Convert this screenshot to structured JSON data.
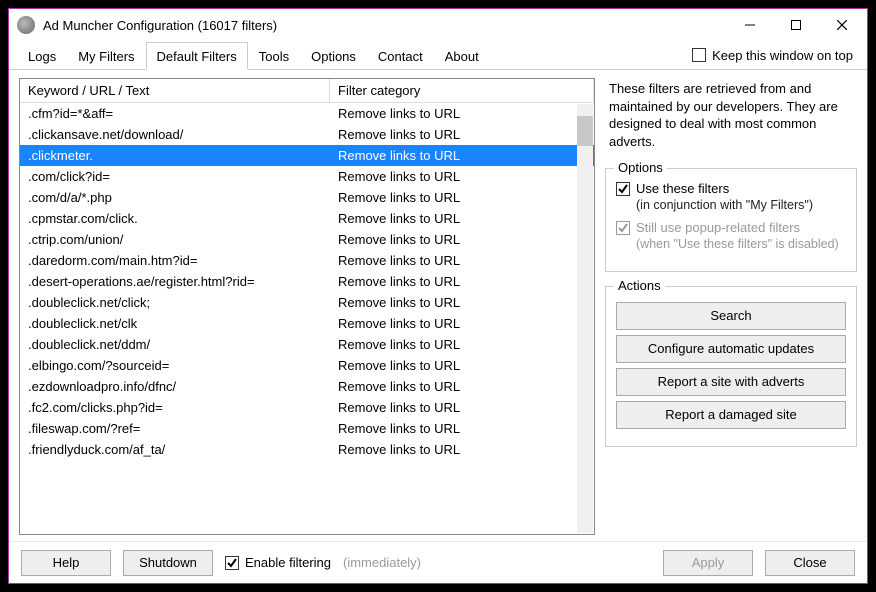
{
  "window": {
    "title": "Ad Muncher Configuration (16017 filters)"
  },
  "tabs": [
    "Logs",
    "My Filters",
    "Default Filters",
    "Tools",
    "Options",
    "Contact",
    "About"
  ],
  "active_tab": "Default Filters",
  "keep_on_top": {
    "label": "Keep this window on top",
    "checked": false
  },
  "table": {
    "headers": {
      "col1": "Keyword / URL / Text",
      "col2": "Filter category"
    },
    "rows": [
      {
        "k": ".cfm?id=*&aff=",
        "c": "Remove links to URL",
        "sel": false
      },
      {
        "k": ".clickansave.net/download/",
        "c": "Remove links to URL",
        "sel": false
      },
      {
        "k": ".clickmeter.",
        "c": "Remove links to URL",
        "sel": true
      },
      {
        "k": ".com/click?id=",
        "c": "Remove links to URL",
        "sel": false
      },
      {
        "k": ".com/d/a/*.php",
        "c": "Remove links to URL",
        "sel": false
      },
      {
        "k": ".cpmstar.com/click.",
        "c": "Remove links to URL",
        "sel": false
      },
      {
        "k": ".ctrip.com/union/",
        "c": "Remove links to URL",
        "sel": false
      },
      {
        "k": ".daredorm.com/main.htm?id=",
        "c": "Remove links to URL",
        "sel": false
      },
      {
        "k": ".desert-operations.ae/register.html?rid=",
        "c": "Remove links to URL",
        "sel": false
      },
      {
        "k": ".doubleclick.net/click;",
        "c": "Remove links to URL",
        "sel": false
      },
      {
        "k": ".doubleclick.net/clk",
        "c": "Remove links to URL",
        "sel": false
      },
      {
        "k": ".doubleclick.net/ddm/",
        "c": "Remove links to URL",
        "sel": false
      },
      {
        "k": ".elbingo.com/?sourceid=",
        "c": "Remove links to URL",
        "sel": false
      },
      {
        "k": ".ezdownloadpro.info/dfnc/",
        "c": "Remove links to URL",
        "sel": false
      },
      {
        "k": ".fc2.com/clicks.php?id=",
        "c": "Remove links to URL",
        "sel": false
      },
      {
        "k": ".fileswap.com/?ref=",
        "c": "Remove links to URL",
        "sel": false
      },
      {
        "k": ".friendlyduck.com/af_ta/",
        "c": "Remove links to URL",
        "sel": false
      }
    ]
  },
  "info_text": "These filters are retrieved from and maintained by our developers.  They are designed to deal with most common adverts.",
  "options_group": {
    "legend": "Options",
    "use_filters": {
      "label": "Use these filters",
      "checked": true
    },
    "use_filters_note": "(in conjunction with \"My Filters\")",
    "still_popup": {
      "label": "Still use popup-related filters",
      "checked": true,
      "disabled": true
    },
    "still_popup_note": "(when \"Use these filters\" is disabled)"
  },
  "actions_group": {
    "legend": "Actions",
    "buttons": {
      "search": "Search",
      "configure": "Configure automatic updates",
      "report_adverts": "Report a site with adverts",
      "report_damaged": "Report a damaged site"
    }
  },
  "footer": {
    "help": "Help",
    "shutdown": "Shutdown",
    "enable_filtering": {
      "label": "Enable filtering",
      "checked": true
    },
    "immediately": "(immediately)",
    "apply": "Apply",
    "close": "Close"
  }
}
